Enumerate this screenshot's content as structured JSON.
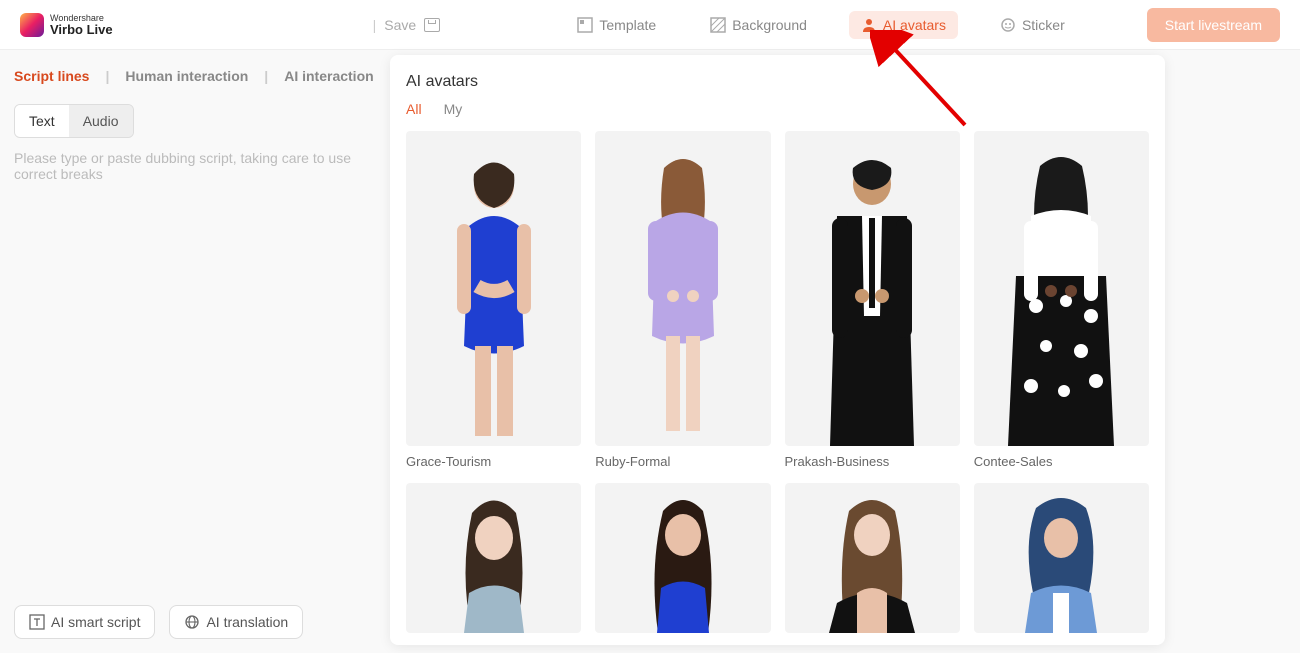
{
  "brand": {
    "line1": "Wondershare",
    "line2": "Virbo Live"
  },
  "toolbar": {
    "save": "Save"
  },
  "nav": {
    "template": "Template",
    "background": "Background",
    "avatars": "AI avatars",
    "sticker": "Sticker",
    "start": "Start livestream"
  },
  "sidebar": {
    "tabs": {
      "script": "Script lines",
      "human": "Human interaction",
      "ai": "AI interaction"
    },
    "mode": {
      "text": "Text",
      "audio": "Audio"
    },
    "placeholder": "Please type or paste dubbing script, taking care to use correct breaks",
    "smart": "AI smart script",
    "translate": "AI translation"
  },
  "panel": {
    "title": "AI avatars",
    "filters": {
      "all": "All",
      "my": "My"
    },
    "avatars": [
      {
        "name": "Grace-Tourism"
      },
      {
        "name": "Ruby-Formal"
      },
      {
        "name": "Prakash-Business"
      },
      {
        "name": "Contee-Sales"
      },
      {
        "name": ""
      },
      {
        "name": ""
      },
      {
        "name": ""
      },
      {
        "name": ""
      }
    ]
  },
  "colors": {
    "accent": "#e85c2f"
  }
}
